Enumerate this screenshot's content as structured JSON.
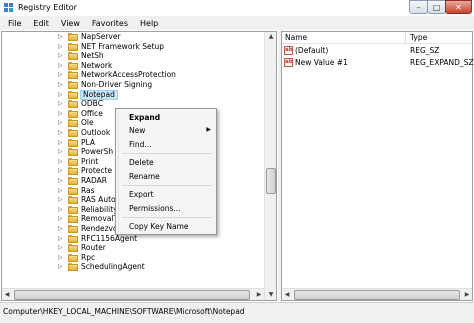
{
  "window": {
    "title": "Registry Editor"
  },
  "menubar": {
    "items": [
      "File",
      "Edit",
      "View",
      "Favorites",
      "Help"
    ]
  },
  "tree": {
    "items": [
      {
        "label": "NapServer"
      },
      {
        "label": "NET Framework Setup"
      },
      {
        "label": "NetSh"
      },
      {
        "label": "Network"
      },
      {
        "label": "NetworkAccessProtection"
      },
      {
        "label": "Non-Driver Signing"
      },
      {
        "label": "Notepad",
        "selected": true
      },
      {
        "label": "ODBC"
      },
      {
        "label": "Office"
      },
      {
        "label": "Ole"
      },
      {
        "label": "Outlook"
      },
      {
        "label": "PLA"
      },
      {
        "label": "PowerSh"
      },
      {
        "label": "Print"
      },
      {
        "label": "Protecte"
      },
      {
        "label": "RADAR"
      },
      {
        "label": "Ras"
      },
      {
        "label": "RAS Auto"
      },
      {
        "label": "Reliability Analysis"
      },
      {
        "label": "RemovalTools"
      },
      {
        "label": "RendezvousApps"
      },
      {
        "label": "RFC1156Agent"
      },
      {
        "label": "Router"
      },
      {
        "label": "Rpc"
      },
      {
        "label": "SchedulingAgent"
      }
    ]
  },
  "list": {
    "columns": {
      "name": "Name",
      "type": "Type"
    },
    "rows": [
      {
        "icon": "ab",
        "name": "(Default)",
        "type": "REG_SZ"
      },
      {
        "icon": "ab",
        "name": "New Value #1",
        "type": "REG_EXPAND_SZ"
      }
    ]
  },
  "context_menu": {
    "expand": "Expand",
    "new": "New",
    "find": "Find...",
    "delete": "Delete",
    "rename": "Rename",
    "export": "Export",
    "permissions": "Permissions...",
    "copy_key_name": "Copy Key Name"
  },
  "statusbar": {
    "path": "Computer\\HKEY_LOCAL_MACHINE\\SOFTWARE\\Microsoft\\Notepad"
  },
  "colors": {
    "selection": "#cde8ff",
    "folder": "#e2b33f",
    "close": "#c7432b"
  }
}
